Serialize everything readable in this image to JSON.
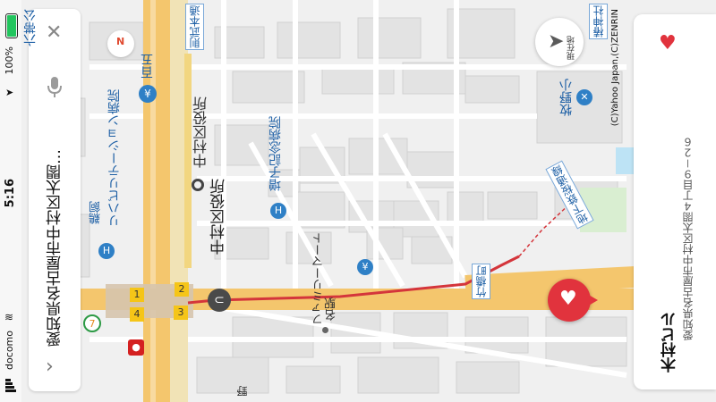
{
  "status": {
    "carrier": "docomo",
    "time": "5:16",
    "battery": "100%"
  },
  "search": {
    "query": "愛知県名古屋市中村区太閤…",
    "mic": "mic-icon",
    "close": "close-icon",
    "back": "chevron-right-icon",
    "compass_label": "N"
  },
  "place": {
    "name": "木村ビル",
    "address": "愛知県名古屋市中村区太閤４丁目９－２６"
  },
  "controls": {
    "current_location_label": "現在地",
    "copyright": "(C)Yahoo Japan,(C)ZENRIN"
  },
  "map": {
    "labels": {
      "rokutai": "六帯公",
      "seiki": "則武本通",
      "hyakugo": "百五",
      "ward_office": "中村区役所",
      "hospital": "増子記念病院",
      "rehab": "リハビリテーション病院",
      "tsurukai": "鵜飼",
      "station": "中村区役所",
      "familymart": "ファミリーマート",
      "meieki": "名駅",
      "chikutacho": "竹橋町",
      "subway_line": "地下鉄桜通線",
      "tsubaki": "椿神社",
      "makino": "牧野小",
      "no": "野"
    },
    "exits": [
      "1",
      "2",
      "3",
      "4"
    ],
    "colors": {
      "route": "#d4353b",
      "road": "#f4c66d",
      "pin": "#e1333d"
    }
  }
}
